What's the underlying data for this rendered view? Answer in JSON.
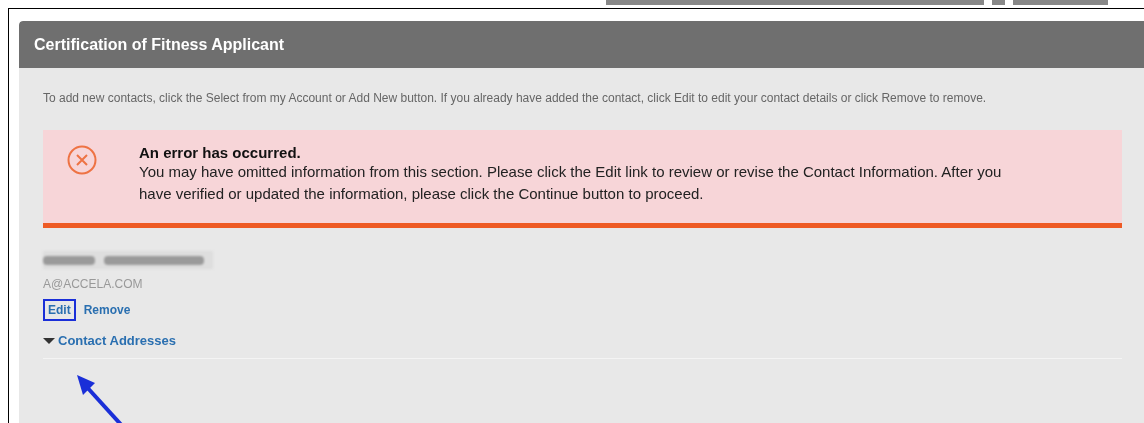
{
  "panel": {
    "title": "Certification of Fitness Applicant"
  },
  "instructions": "To add new contacts, click the Select from my Account or Add New button. If you already have added the contact, click Edit to edit your contact details or click Remove to remove.",
  "error": {
    "title": "An error has occurred.",
    "message": "You may have omitted information from this section. Please click the Edit link to review or revise the Contact Information. After you have verified or updated the information, please click the Continue button to proceed."
  },
  "contact": {
    "email": "A@ACCELA.COM",
    "actions": [
      {
        "label": "Edit",
        "highlighted": true
      },
      {
        "label": "Remove",
        "highlighted": false
      }
    ]
  },
  "section": {
    "label": "Contact Addresses",
    "expanded": true
  }
}
